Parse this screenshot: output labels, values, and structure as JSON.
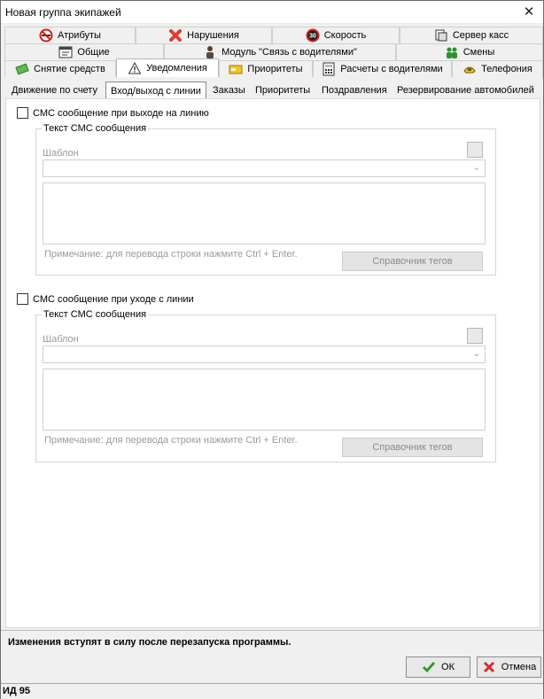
{
  "window": {
    "title": "Новая группа экипажей",
    "close_glyph": "✕"
  },
  "tabs": {
    "row1": [
      "Атрибуты",
      "Нарушения",
      "Скорость",
      "Сервер касс"
    ],
    "row2": [
      "Общие",
      "Модуль \"Связь с водителями\"",
      "Смены"
    ],
    "row3": [
      "Снятие средств",
      "Уведомления",
      "Приоритеты",
      "Расчеты с водителями",
      "Телефония"
    ],
    "active": "Уведомления"
  },
  "subtabs": {
    "items": [
      "Движение по счету",
      "Вход/выход с линии",
      "Заказы",
      "Приоритеты",
      "Поздравления",
      "Резервирование автомобилей"
    ],
    "active": "Вход/выход с линии"
  },
  "section1": {
    "checkbox_label": "СМС сообщение при выходе на линию",
    "group_title": "Текст СМС сообщения",
    "template_label": "Шаблон",
    "hint": "Примечание: для перевода строки нажмите Ctrl + Enter.",
    "tags_button": "Справочник тегов"
  },
  "section2": {
    "checkbox_label": "СМС сообщение при уходе с линии",
    "group_title": "Текст СМС сообщения",
    "template_label": "Шаблон",
    "hint": "Примечание: для перевода строки нажмите Ctrl + Enter.",
    "tags_button": "Справочник тегов"
  },
  "footer": {
    "note": "Изменения вступят в силу после перезапуска программы.",
    "ok_label": "ОК",
    "cancel_label": "Отмена",
    "status": "ИД 95"
  },
  "icons": {
    "attributes": "no-smoking-icon",
    "violations": "red-x-icon",
    "speed": "speed-30-icon",
    "cash_server": "cash-register-icon",
    "general": "settings-window-icon",
    "driver_module": "driver-icon",
    "shifts": "people-icon",
    "withdrawal": "money-icon",
    "notifications": "warning-icon",
    "priorities": "priority-card-icon",
    "driver_accounts": "calculator-icon",
    "telephony": "phone-icon"
  },
  "colors": {
    "active_tab": "#ffffff",
    "window_bg": "#f0f0f0",
    "disabled_text": "#9a9a9a",
    "ok_check": "#2e9d2e",
    "cancel_x": "#d52b2b"
  }
}
